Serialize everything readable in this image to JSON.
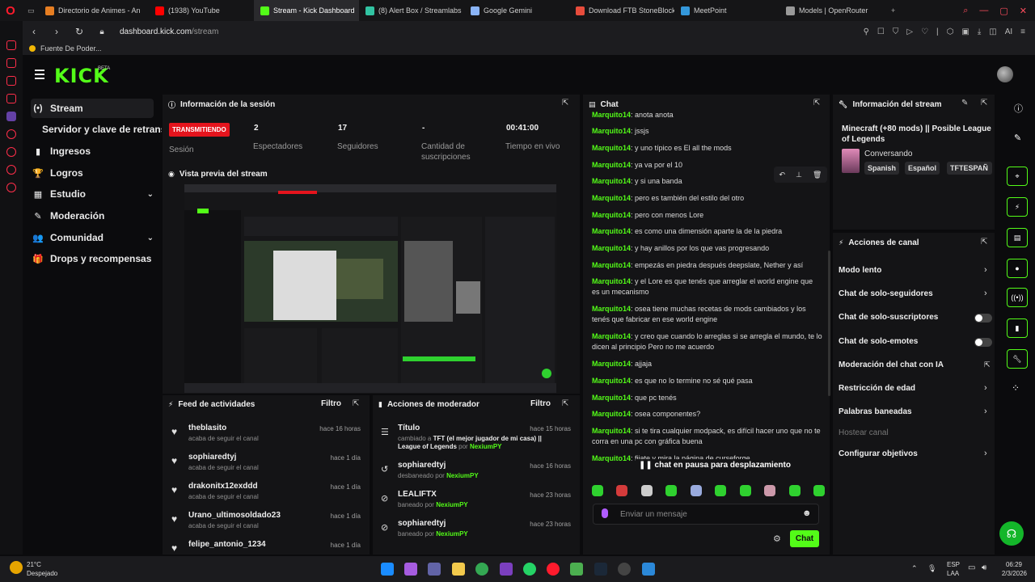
{
  "browser": {
    "tabs": [
      {
        "label": "Directorio de Animes - An",
        "color": "#e67e22"
      },
      {
        "label": "(1938) YouTube",
        "color": "#ff0000"
      },
      {
        "label": "Stream - Kick Dashboard",
        "color": "#53fc18"
      },
      {
        "label": "(8) Alert Box / Streamlabs",
        "color": "#31c3a2"
      },
      {
        "label": "Google Gemini",
        "color": "#8ab4f8"
      },
      {
        "label": "Download FTB StoneBlock",
        "color": "#e74c3c"
      },
      {
        "label": "MeetPoint",
        "color": "#3498db"
      },
      {
        "label": "Models | OpenRouter",
        "color": "#999999"
      }
    ],
    "url_domain": "dashboard.kick.com",
    "url_path": "/stream",
    "bookmark": "Fuente De Poder...",
    "ai_label": "AI"
  },
  "kick": {
    "logo": "KICK",
    "beta": "BETA"
  },
  "nav": {
    "items": [
      {
        "label": "Stream",
        "icon": "(•)"
      },
      {
        "label": "Servidor y clave de retransm",
        "icon": ""
      },
      {
        "label": "Ingresos",
        "icon": "▮"
      },
      {
        "label": "Logros",
        "icon": "🏆"
      },
      {
        "label": "Estudio",
        "icon": "▦"
      },
      {
        "label": "Moderación",
        "icon": "✎"
      },
      {
        "label": "Comunidad",
        "icon": "👥"
      },
      {
        "label": "Drops y recompensas",
        "icon": "🎁"
      }
    ]
  },
  "session": {
    "title": "Información de la sesión",
    "live_badge": "TRANSMITIENDO",
    "session_label": "Sesión",
    "stats": [
      {
        "value": "2",
        "label": "Espectadores"
      },
      {
        "value": "17",
        "label": "Seguidores"
      },
      {
        "value": "-",
        "label": "Cantidad de suscripciones"
      },
      {
        "value": "00:41:00",
        "label": "Tiempo en vivo"
      }
    ]
  },
  "preview": {
    "title": "Vista previa del stream"
  },
  "feed": {
    "title": "Feed de actividades",
    "filter": "Filtro",
    "items": [
      {
        "user": "theblasito",
        "sub": "acaba de seguir el canal",
        "time": "hace 16 horas"
      },
      {
        "user": "sophiaredtyj",
        "sub": "acaba de seguir el canal",
        "time": "hace 1 día"
      },
      {
        "user": "drakonitx12exddd",
        "sub": "acaba de seguir el canal",
        "time": "hace 1 día"
      },
      {
        "user": "Urano_ultimosoldado23",
        "sub": "acaba de seguir el canal",
        "time": "hace 1 día"
      },
      {
        "user": "felipe_antonio_1234",
        "sub": "",
        "time": "hace 1 día"
      }
    ]
  },
  "modactions": {
    "title": "Acciones de moderador",
    "filter": "Filtro",
    "items": [
      {
        "icon": "☰",
        "title": "Título",
        "prefix": "cambiado a",
        "detail": "TFT (el mejor jugador de mi casa) || League of Legends",
        "by": "por",
        "user": "NexiumPY",
        "time": "hace 15 horas"
      },
      {
        "icon": "↺",
        "title": "sophiaredtyj",
        "prefix": "desbaneado",
        "detail": "",
        "by": "por",
        "user": "NexiumPY",
        "time": "hace 16 horas"
      },
      {
        "icon": "⊘",
        "title": "LEALIFTX",
        "prefix": "baneado",
        "detail": "",
        "by": "por",
        "user": "NexiumPY",
        "time": "hace 23 horas"
      },
      {
        "icon": "⊘",
        "title": "sophiaredtyj",
        "prefix": "baneado",
        "detail": "",
        "by": "por",
        "user": "NexiumPY",
        "time": "hace 23 horas"
      }
    ]
  },
  "chat": {
    "title": "Chat",
    "messages": [
      {
        "user": "Marquito14",
        "text": "anota anota"
      },
      {
        "user": "Marquito14",
        "text": "jssjs"
      },
      {
        "user": "Marquito14",
        "text": "y uno típico es El all the mods"
      },
      {
        "user": "Marquito14",
        "text": "ya va por el 10"
      },
      {
        "user": "Marquito14",
        "text": "y si una banda"
      },
      {
        "user": "Marquito14",
        "text": "pero es también del estilo del otro"
      },
      {
        "user": "Marquito14",
        "text": "pero con menos Lore"
      },
      {
        "user": "Marquito14",
        "text": "es como una dimensión aparte la de la piedra"
      },
      {
        "user": "Marquito14",
        "text": "y hay anillos por los que vas progresando"
      },
      {
        "user": "Marquito14",
        "text": "empezás en piedra después deepslate, Nether y así"
      },
      {
        "user": "Marquito14",
        "text": "y el Lore es que tenés que arreglar el world engine que es un mecanismo"
      },
      {
        "user": "Marquito14",
        "text": "osea tiene muchas recetas de mods cambiados y los tenés que fabricar en ese world engine"
      },
      {
        "user": "Marquito14",
        "text": "y creo que cuando lo arreglas si se arregla el mundo, te lo dicen al principio Pero no me acuerdo"
      },
      {
        "user": "Marquito14",
        "text": "ajjaja"
      },
      {
        "user": "Marquito14",
        "text": "es que no lo termine no sé qué pasa"
      },
      {
        "user": "Marquito14",
        "text": "que pc tenés"
      },
      {
        "user": "Marquito14",
        "text": "osea componentes?"
      },
      {
        "user": "Marquito14",
        "text": "si te tira cualquier modpack, es difícil hacer uno que no te corra en una pc con gráfica buena"
      },
      {
        "user": "Marquito14",
        "text": "fijate y mira la página de curseforge"
      }
    ],
    "paused": "chat en pausa para desplazamiento",
    "input_placeholder": "Enviar un mensaje",
    "send": "Chat"
  },
  "streaminfo": {
    "title": "Información del stream",
    "stream_title": "Minecraft (+80 mods) || Posible League of Legends",
    "category": "Conversando",
    "tags": [
      "Spanish",
      "Español",
      "TFTESPAÑ"
    ]
  },
  "channel": {
    "title": "Acciones de canal",
    "actions": [
      {
        "label": "Modo lento",
        "control": "chevron"
      },
      {
        "label": "Chat de solo-seguidores",
        "control": "chevron"
      },
      {
        "label": "Chat de solo-suscriptores",
        "control": "toggle"
      },
      {
        "label": "Chat de solo-emotes",
        "control": "toggle"
      },
      {
        "label": "Moderación del chat con IA",
        "control": "external"
      },
      {
        "label": "Restricción de edad",
        "control": "chevron"
      },
      {
        "label": "Palabras baneadas",
        "control": "chevron"
      },
      {
        "label": "Hostear canal",
        "control": "none"
      },
      {
        "label": "Configurar objetivos",
        "control": "chevron"
      }
    ]
  },
  "taskbar": {
    "temp": "21°C",
    "weather": "Despejado",
    "lang1": "ESP",
    "lang2": "LAA",
    "time": "06:29",
    "date": "2/3/2026"
  }
}
